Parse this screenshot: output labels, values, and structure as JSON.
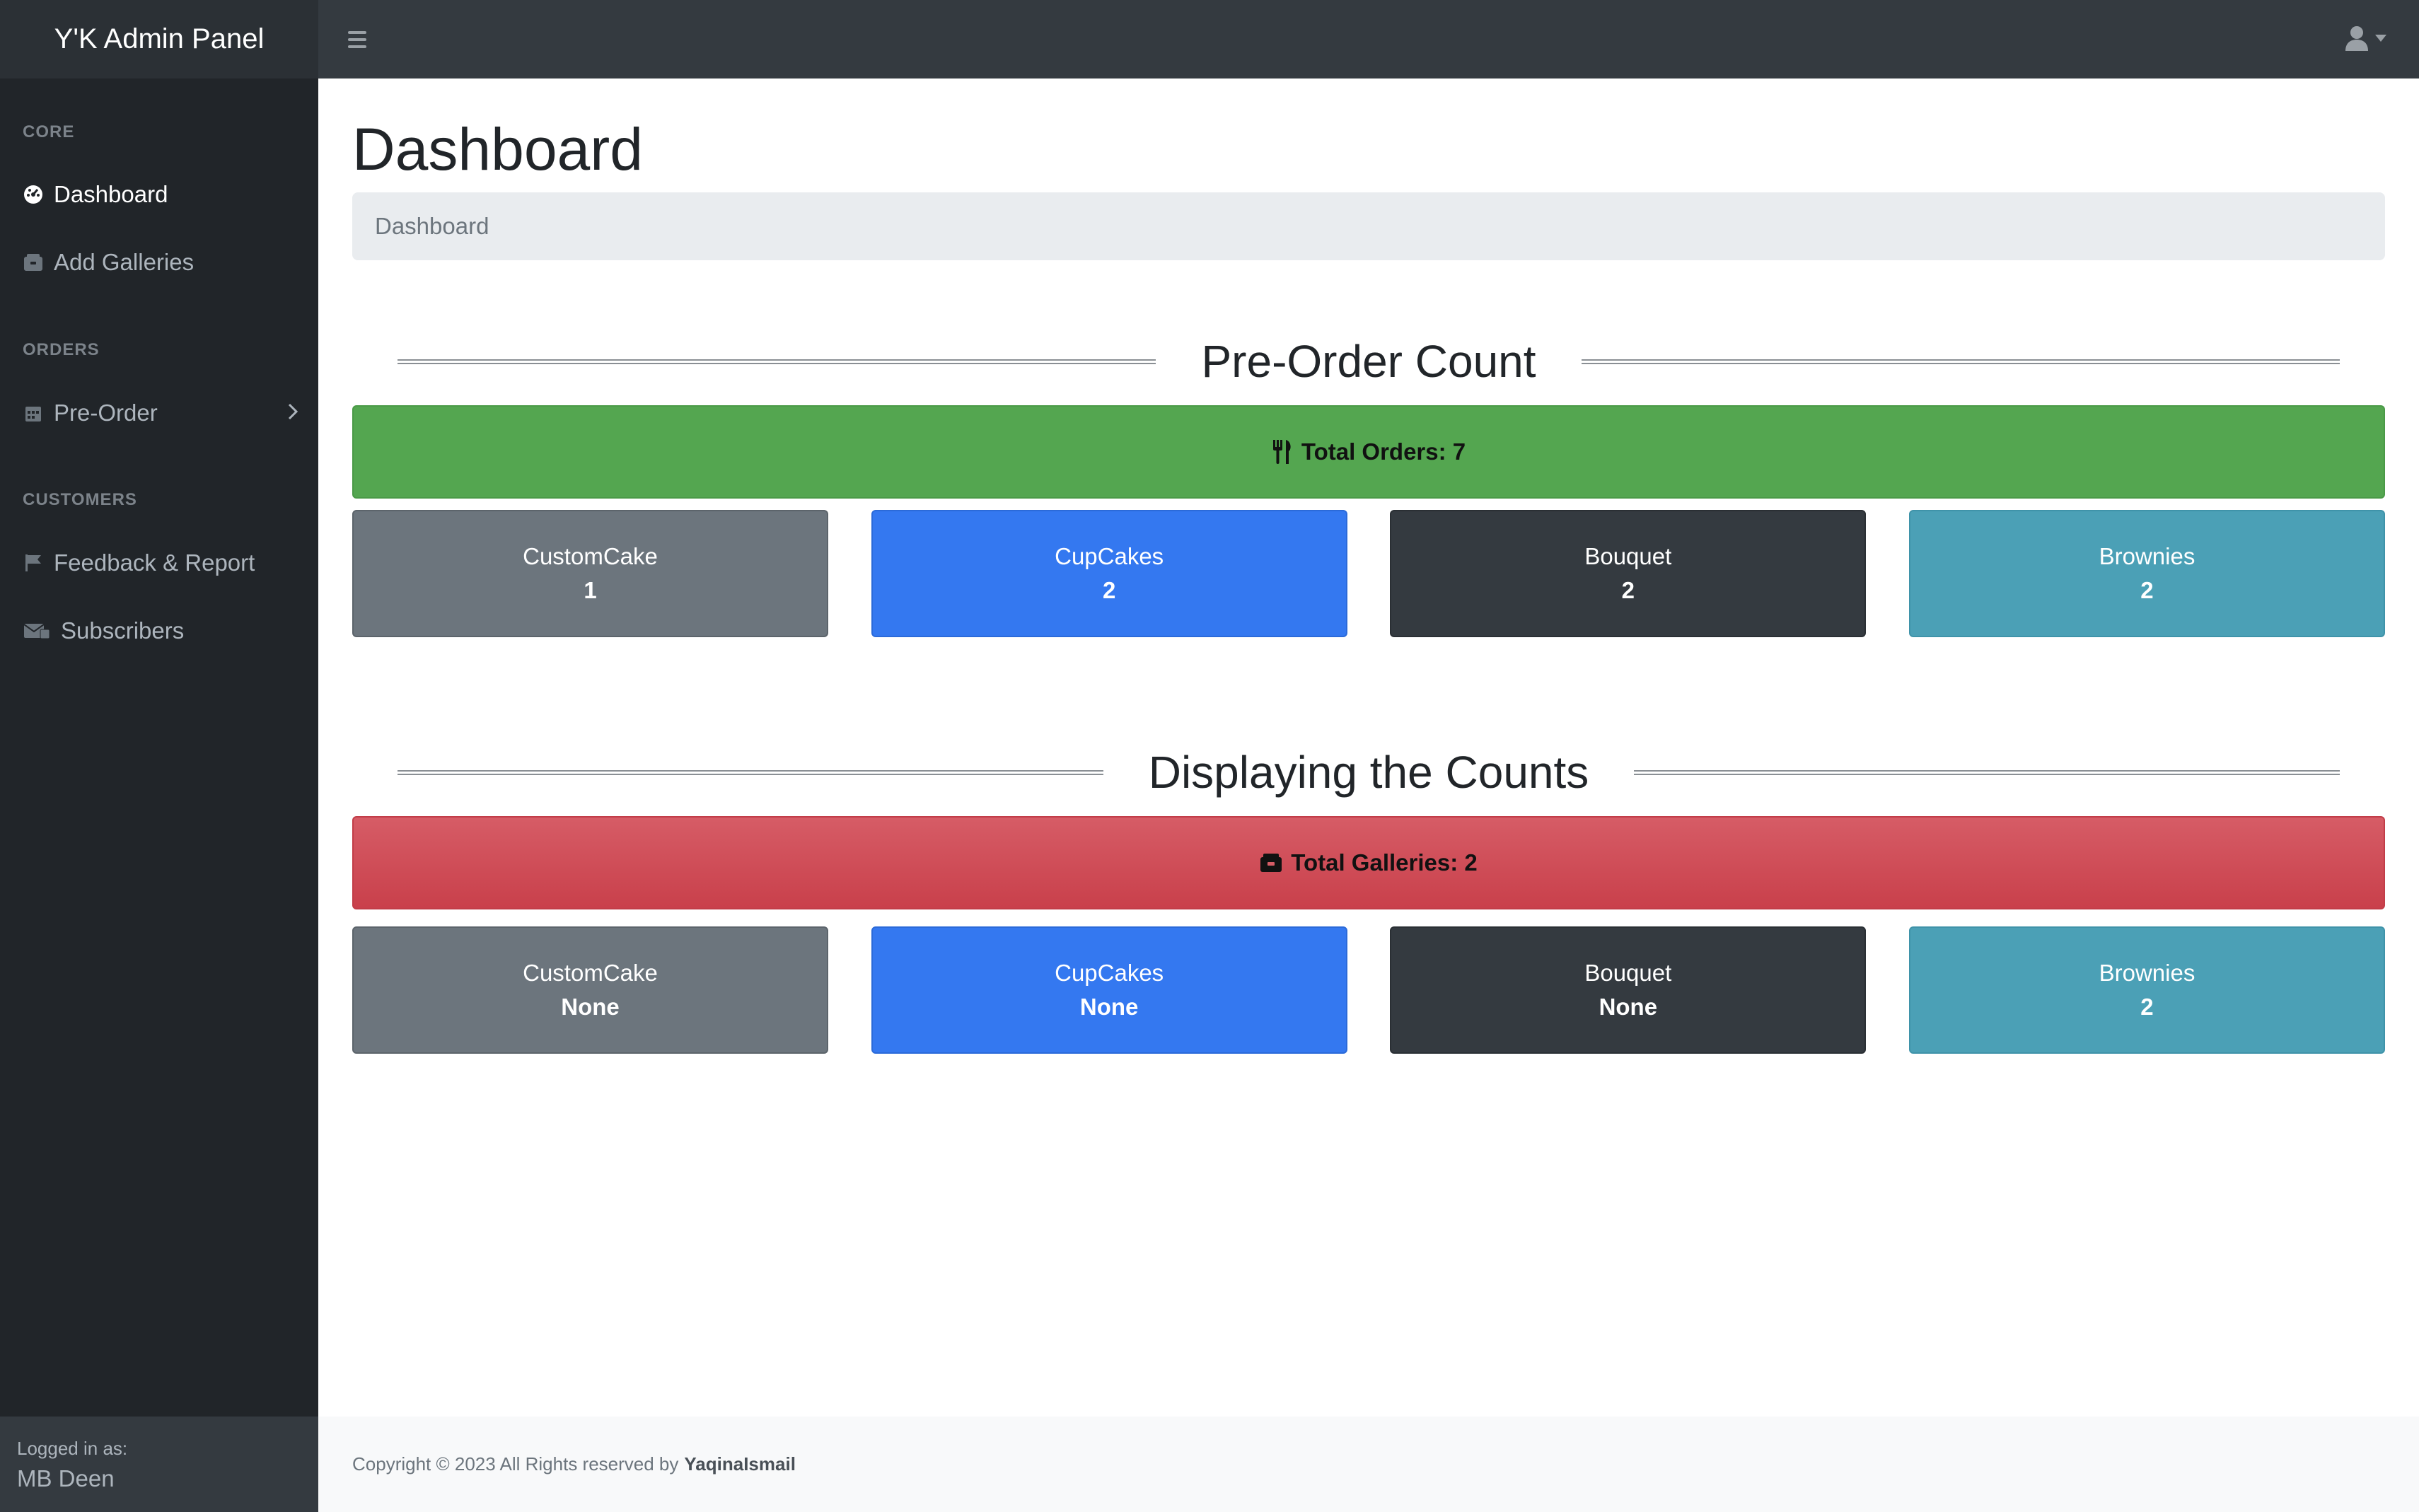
{
  "navbar": {
    "brand": "Y'K Admin Panel",
    "toggle_icon": "hamburger-icon",
    "user_icon": "user-icon"
  },
  "sidebar": {
    "sections": [
      {
        "heading": "CORE"
      },
      {
        "heading": "ORDERS"
      },
      {
        "heading": "CUSTOMERS"
      }
    ],
    "items": [
      {
        "label": "Dashboard",
        "icon": "dashboard-icon",
        "active": true
      },
      {
        "label": "Add Galleries",
        "icon": "gallery-icon",
        "active": false
      },
      {
        "label": "Pre-Order",
        "icon": "calendar-icon",
        "active": false
      },
      {
        "label": "Feedback & Report",
        "icon": "flag-icon",
        "active": false
      },
      {
        "label": "Subscribers",
        "icon": "envelope-icon",
        "active": false
      }
    ],
    "footer": {
      "label": "Logged in as:",
      "user": "MB Deen"
    }
  },
  "main": {
    "title": "Dashboard",
    "breadcrumb": "Dashboard",
    "preorder": {
      "section_title": "Pre-Order Count",
      "banner_label": "Total Orders: 7",
      "banner_icon": "utensils-icon",
      "cards": [
        {
          "name": "CustomCake",
          "value": "1",
          "color": "#6c757d"
        },
        {
          "name": "CupCakes",
          "value": "2",
          "color": "#3478f0"
        },
        {
          "name": "Bouquet",
          "value": "2",
          "color": "#343a40"
        },
        {
          "name": "Brownies",
          "value": "2",
          "color": "#4ba0b6"
        }
      ]
    },
    "galleries": {
      "section_title": "Displaying the Counts",
      "banner_label": "Total Galleries: 2",
      "banner_icon": "gallery-icon",
      "cards": [
        {
          "name": "CustomCake",
          "value": "None",
          "color": "#6c757d"
        },
        {
          "name": "CupCakes",
          "value": "None",
          "color": "#3478f0"
        },
        {
          "name": "Bouquet",
          "value": "None",
          "color": "#343a40"
        },
        {
          "name": "Brownies",
          "value": "2",
          "color": "#4ba0b6"
        }
      ]
    }
  },
  "footer": {
    "copyright": "Copyright © 2023 All Rights reserved by",
    "author": "YaqinaIsmail"
  },
  "colors": {
    "success": "#54a650",
    "danger": "#c9404b",
    "sidebar_bg": "#212529",
    "navbar_bg": "#343a40"
  }
}
